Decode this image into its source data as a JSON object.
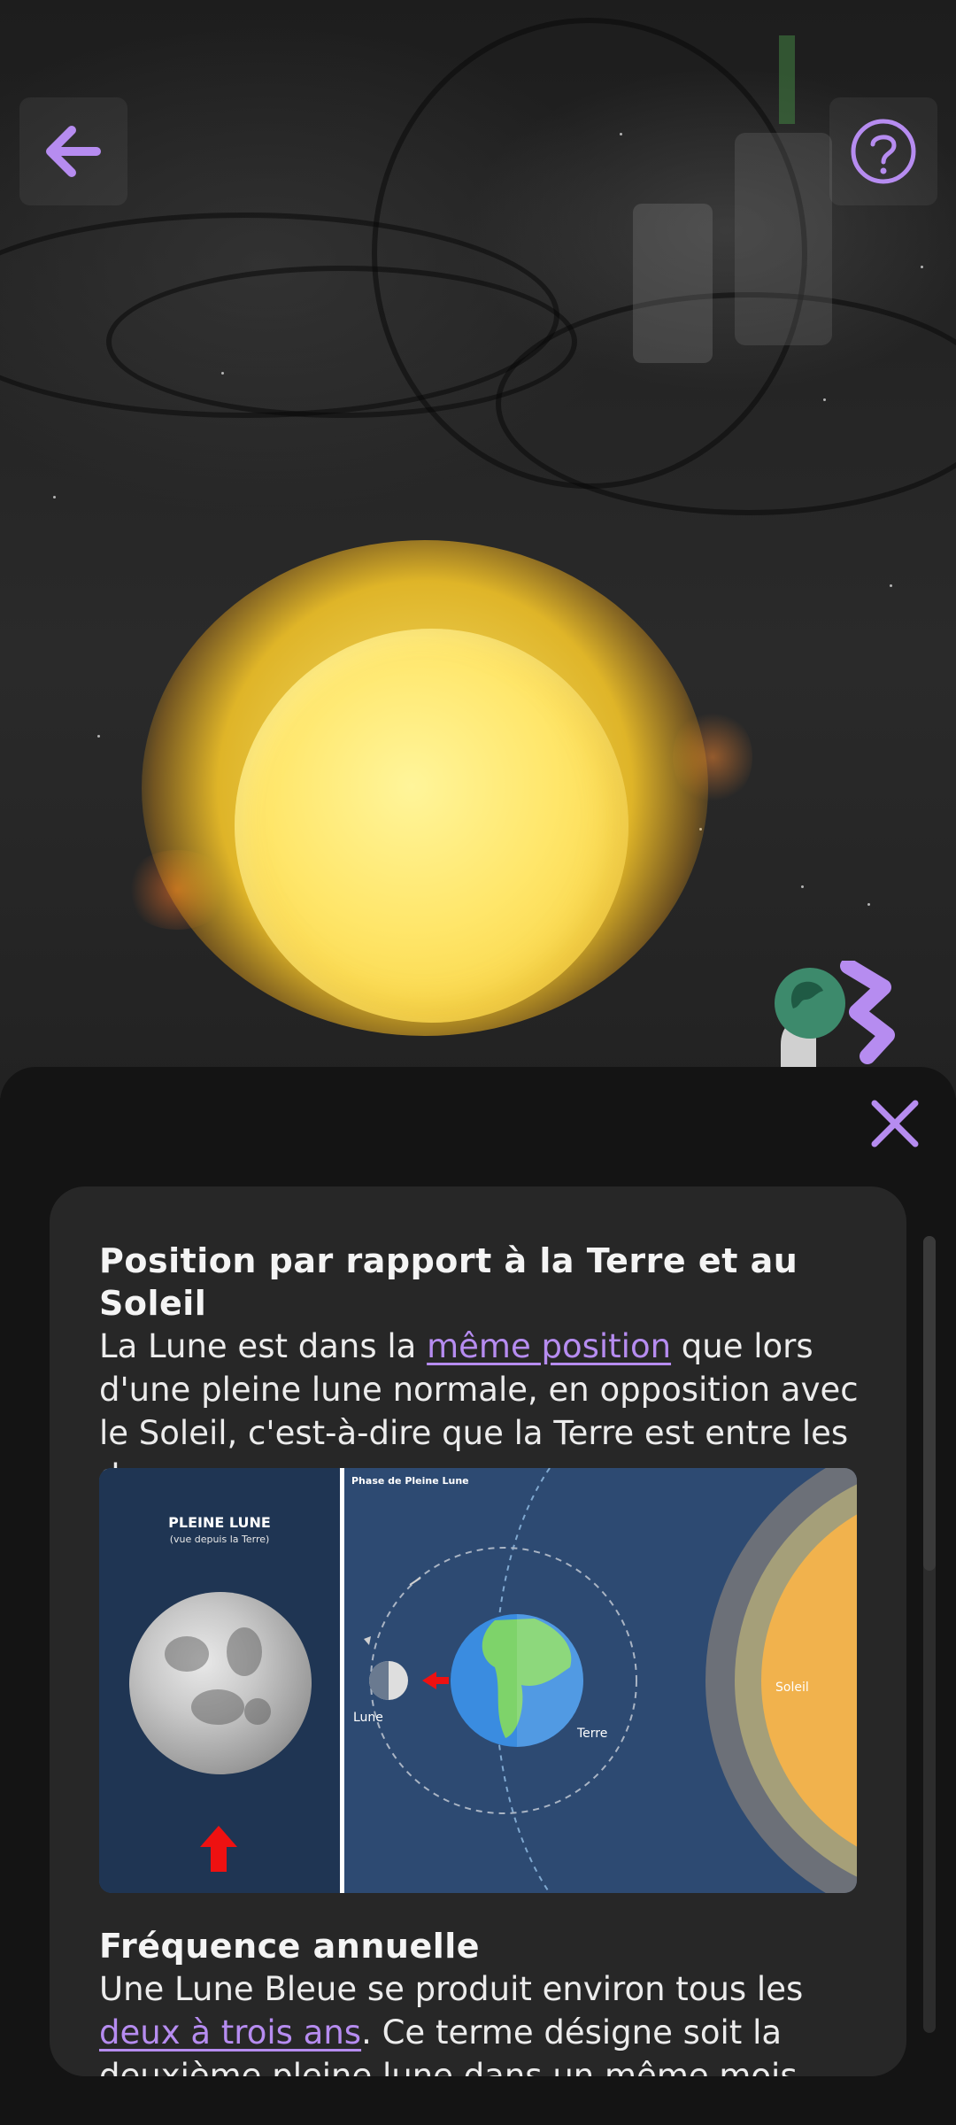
{
  "header": {
    "back_icon": "arrow-left-icon",
    "help_icon": "question-circle-icon"
  },
  "colors": {
    "accent": "#b68cf0",
    "panel": "#141414",
    "card": "#272727"
  },
  "panel": {
    "close_icon": "close-icon",
    "section1": {
      "title": "Position par rapport à la Terre et au Soleil",
      "text_before_link": "La Lune est dans la ",
      "link": "même position",
      "text_after_link": " que lors d'une pleine lune normale, en opposition avec le Soleil, c'est-à-dire que la Terre est entre les deux."
    },
    "diagram": {
      "left_title": "PLEINE LUNE",
      "left_subtitle": "(vue depuis la Terre)",
      "right_title": "Phase de Pleine Lune",
      "moon_label": "Lune",
      "earth_label": "Terre",
      "sun_label": "Soleil"
    },
    "section2": {
      "title": "Fréquence annuelle",
      "text_before_link": "Une Lune Bleue se produit environ tous les ",
      "link": "deux à trois ans",
      "text_after_link": ". Ce terme désigne soit la deuxième pleine lune dans un même mois (Lune Bleue"
    }
  }
}
